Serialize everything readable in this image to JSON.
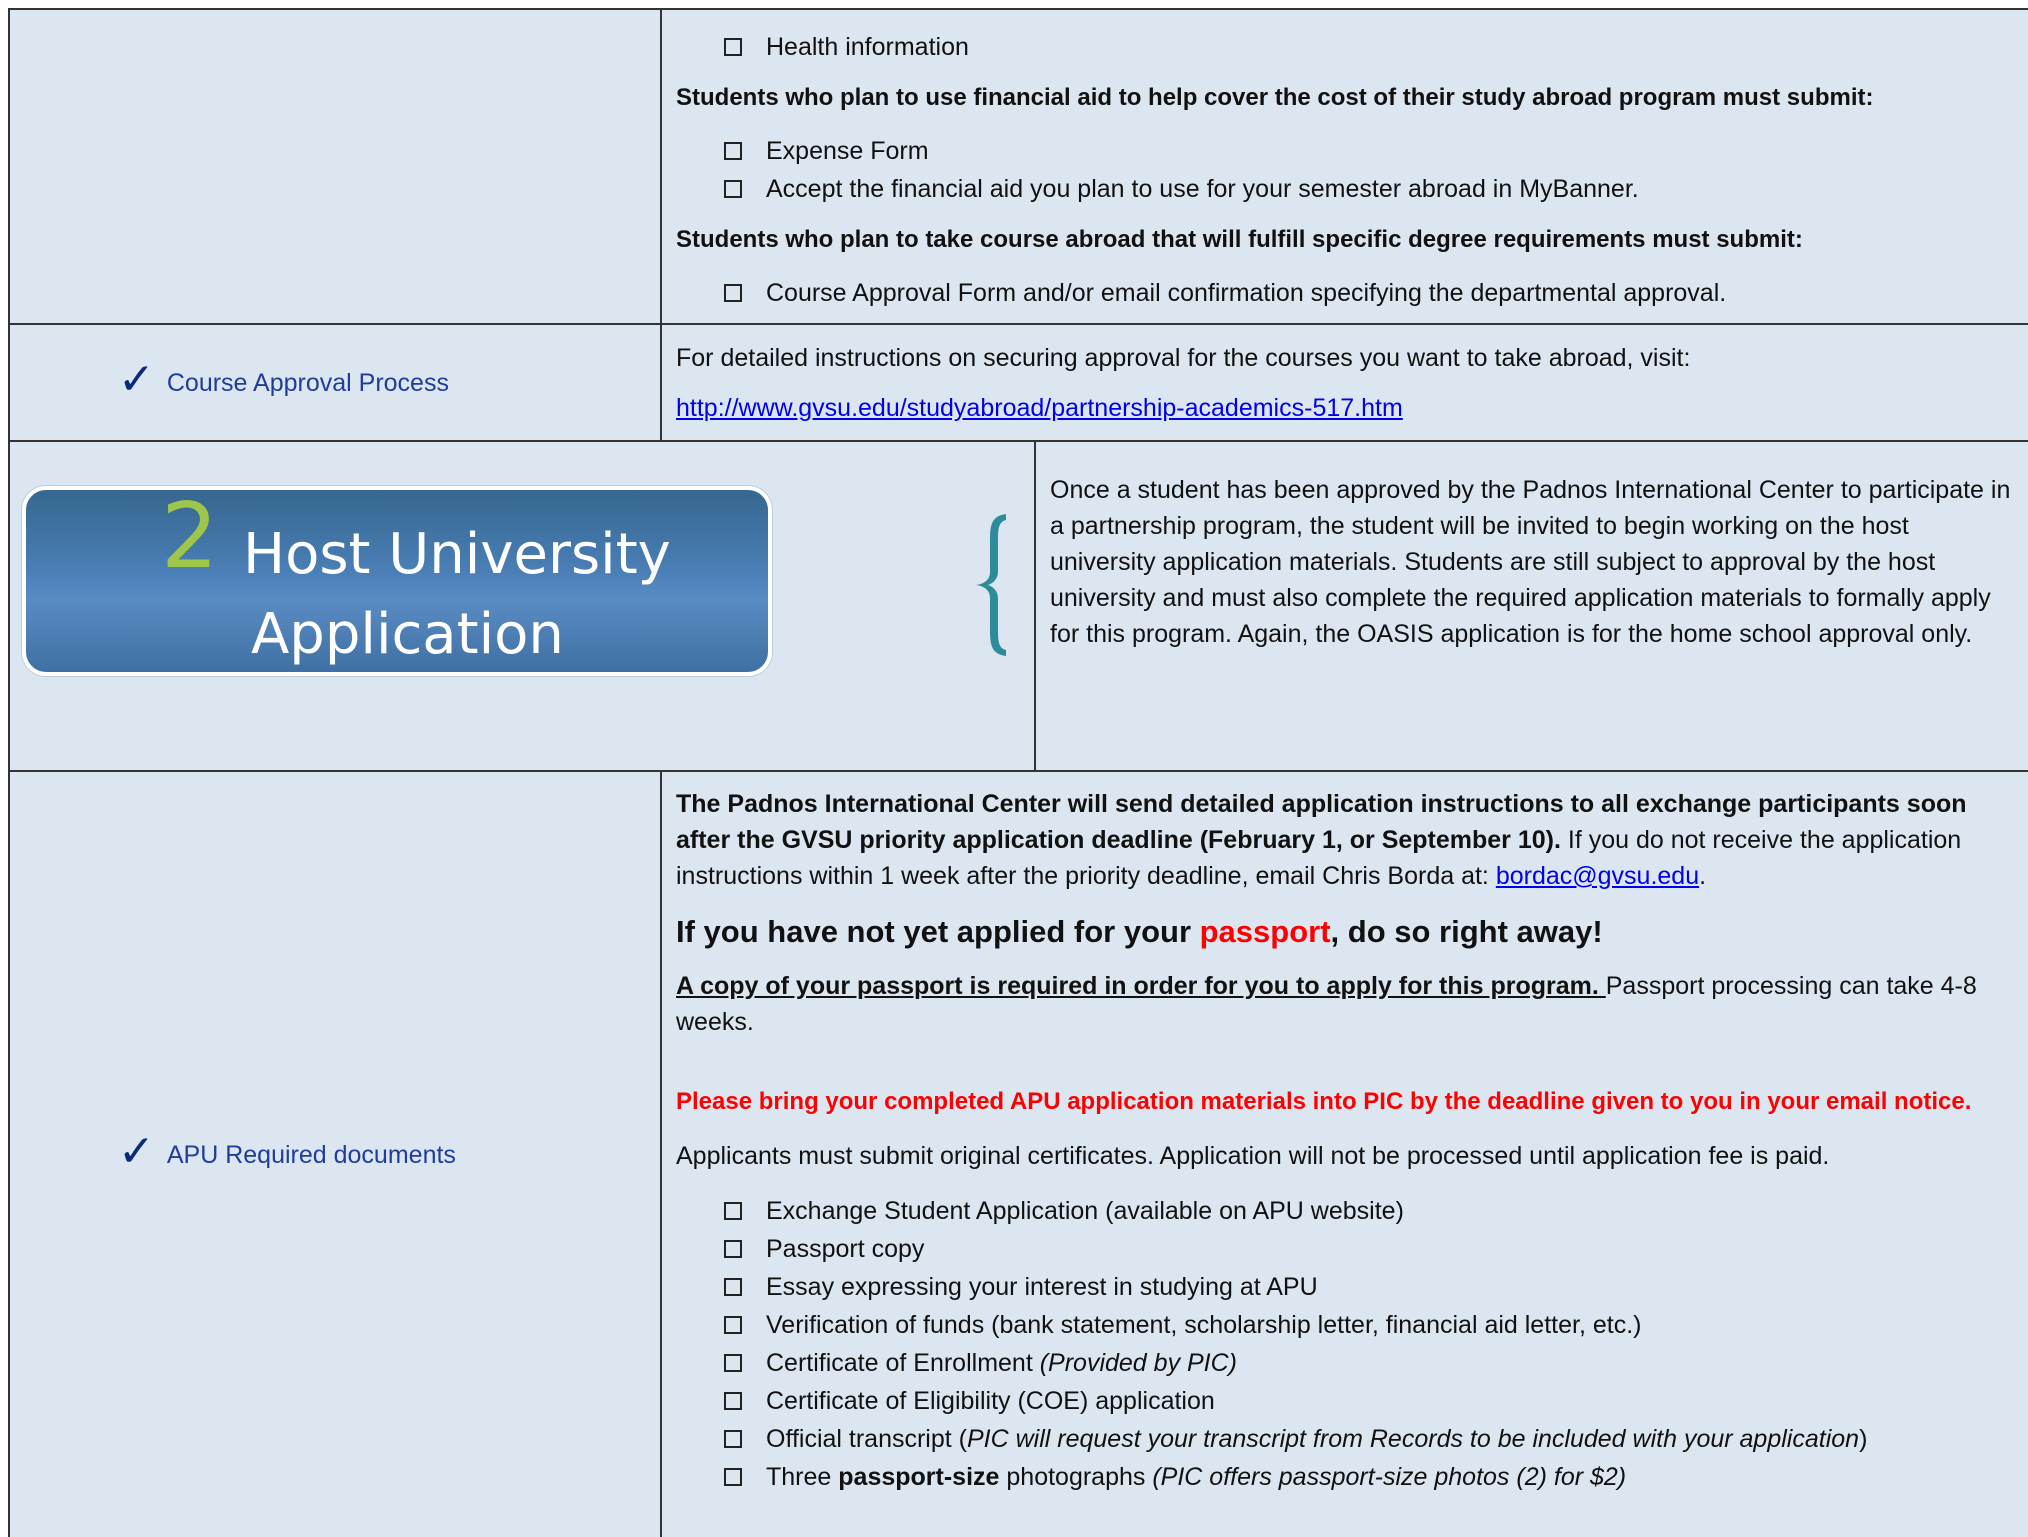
{
  "row1": {
    "items_a": [
      "Health information"
    ],
    "heading_fin": "Students who plan to use financial aid to help cover the cost of their study abroad program must submit:",
    "items_fin": [
      "Expense Form",
      "Accept the financial aid you plan to use for your semester abroad in MyBanner."
    ],
    "heading_course": "Students who plan to take course abroad that will fulfill specific degree requirements must submit:",
    "items_course": [
      "Course Approval Form and/or email confirmation specifying the departmental approval."
    ]
  },
  "row2": {
    "label": "Course Approval Process",
    "instructions": "For detailed instructions on securing approval for the courses you want to take abroad, visit:",
    "link": "http://www.gvsu.edu/studyabroad/partnership-academics-517.htm"
  },
  "banner": {
    "number": "2",
    "title_line1": "Host University",
    "title_line2": "Application",
    "description": "Once a student has been approved by the Padnos International Center to participate in a partnership program, the student will be invited to begin working on the host university application materials. Students are still subject to approval by the host university and must also complete the required application materials to formally apply for this program. Again, the OASIS application is for the home school approval only."
  },
  "row4": {
    "label": "APU Required documents",
    "intro_bold": "The Padnos International Center will send detailed application instructions to all exchange participants soon after the GVSU priority application deadline (February 1, or September 10).",
    "intro_rest": " If you do not receive the application instructions within 1 week after the priority deadline, email Chris Borda at: ",
    "email": "bordac@gvsu.edu",
    "intro_end": ".",
    "passport_pre": "If you have not yet applied for your ",
    "passport_word": "passport",
    "passport_post": ", do so right away!",
    "copy_bold": "A copy of your passport is required in order for you to apply for this program. ",
    "copy_rest": "Passport processing can take 4-8 weeks.",
    "red_notice": "Please bring your completed APU application materials into PIC by the deadline given to you in your email notice.",
    "applicants": "Applicants must submit original certificates. Application will not be processed until application fee is paid.",
    "items": [
      {
        "text": "Exchange Student Application (available on APU website)"
      },
      {
        "text": "Passport copy"
      },
      {
        "text": "Essay expressing your interest in studying at APU"
      },
      {
        "text": "Verification of funds (bank statement, scholarship letter, financial aid letter, etc.)"
      },
      {
        "text": "Certificate of Enrollment ",
        "italic": "(Provided by PIC)"
      },
      {
        "text": "Certificate of Eligibility (COE) application"
      },
      {
        "text": "Official transcript (",
        "italic": "PIC will request your transcript from Records to be included with your application",
        "after": ")"
      },
      {
        "text": "Three ",
        "bold": "passport-size",
        "text2": " photographs ",
        "italic": "(PIC offers passport-size photos (2) for $2)"
      }
    ]
  }
}
